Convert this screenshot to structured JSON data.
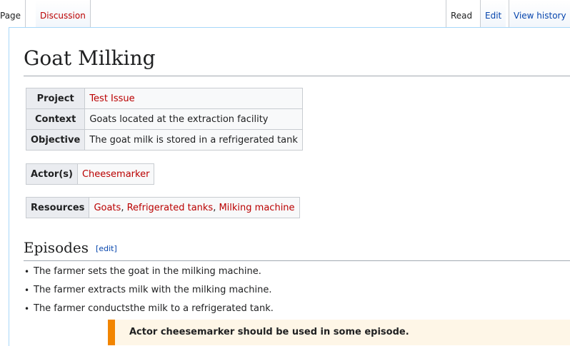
{
  "tabs": {
    "page": "Page",
    "discussion": "Discussion",
    "read": "Read",
    "edit": "Edit",
    "view_history": "View history"
  },
  "title": "Goat Milking",
  "info": {
    "project_label": "Project",
    "project_value": "Test Issue",
    "context_label": "Context",
    "context_value": "Goats located at the extraction facility",
    "objective_label": "Objective",
    "objective_value": "The goat milk is stored in a refrigerated tank"
  },
  "actors": {
    "label": "Actor(s)",
    "value": "Cheesemarker"
  },
  "resources": {
    "label": "Resources",
    "items": [
      "Goats",
      "Refrigerated tanks",
      "Milking machine"
    ],
    "separator": ", "
  },
  "episodes": {
    "heading": "Episodes",
    "edit_open": "[",
    "edit_label": "edit",
    "edit_close": "]",
    "items": [
      "The farmer sets the goat in the milking machine.",
      "The farmer extracts milk with the milking machine.",
      "The farmer conductsthe milk to a refrigerated tank."
    ]
  },
  "warning": {
    "text": "Actor cheesemarker should be used in some episode.",
    "color": "#f28500"
  },
  "colors": {
    "link_red": "#ba0000",
    "link_blue": "#0645ad"
  }
}
